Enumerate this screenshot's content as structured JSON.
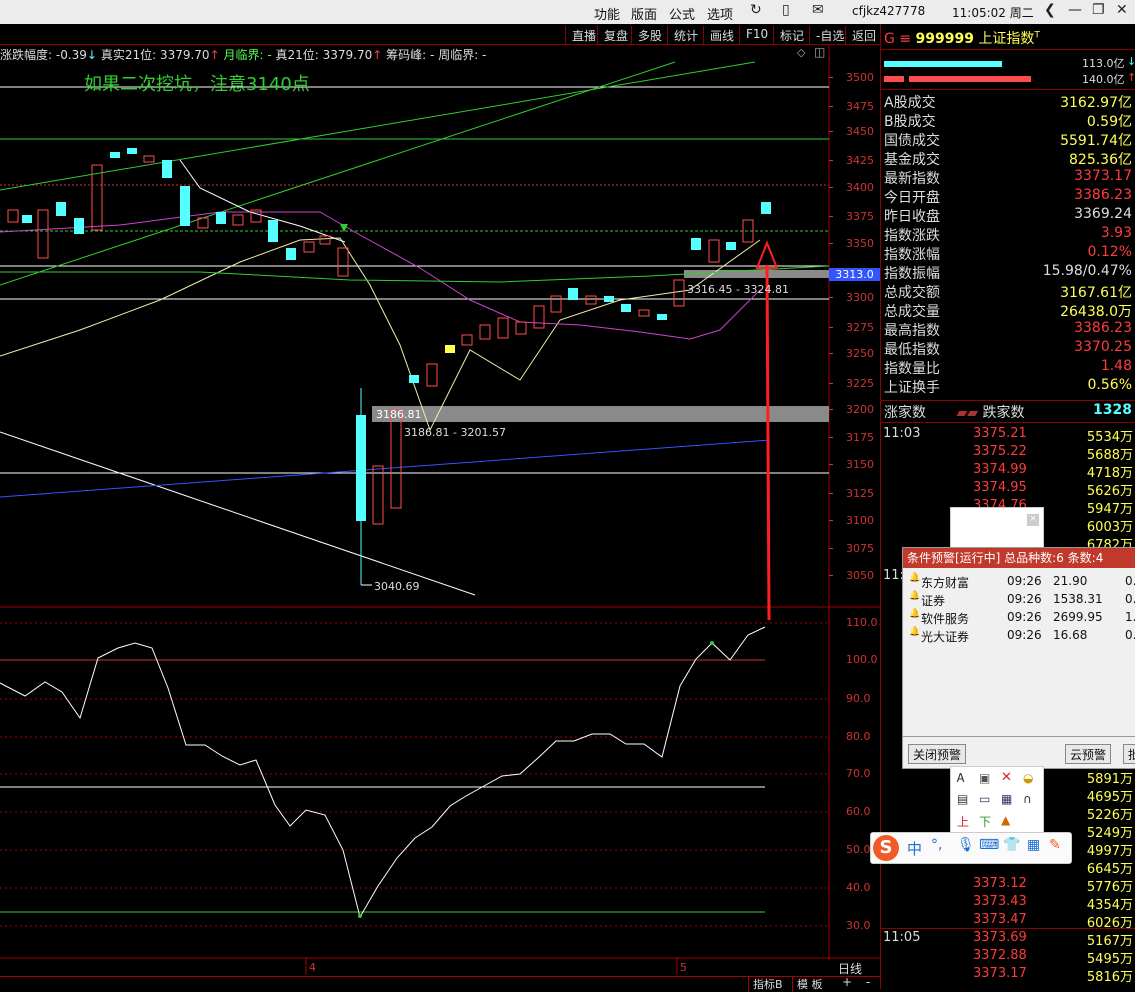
{
  "topbar": {
    "menus": [
      "功能",
      "版面",
      "公式",
      "选项"
    ],
    "user": "cfjkz427778",
    "clock": "11:05:02 周二"
  },
  "toolbar": {
    "buttons": [
      "直播",
      "复盘",
      "多股",
      "统计",
      "画线",
      "F10",
      "标记",
      "-自选",
      "返回"
    ]
  },
  "info_line": {
    "change_pct": "涨跌幅度: -0.39",
    "real21": "真实21位: 3379.70",
    "monthly": "月临界: -",
    "real21b": "真21位: 3379.70",
    "chips": "筹码峰: -",
    "weekly": "周临界: -"
  },
  "annotation": "如果二次挖坑，注意3140点",
  "price_axis": [
    "3500",
    "3475",
    "3450",
    "3425",
    "3400",
    "3375",
    "3350",
    "3300",
    "3275",
    "3250",
    "3225",
    "3200",
    "3175",
    "3150",
    "3125",
    "3100",
    "3075",
    "3050"
  ],
  "price_tag": "3313.0",
  "chart_labels": {
    "zone1": "3186.81",
    "zone1_range": "3186.81 - 3201.57",
    "zone2_range": "3316.45 - 3324.81",
    "low": "3040.69"
  },
  "indicator_axis": [
    "110.0",
    "100.0",
    "90.0",
    "80.0",
    "70.0",
    "60.0",
    "50.0",
    "40.0",
    "30.0"
  ],
  "date_marks": [
    "4",
    "5"
  ],
  "bottom": {
    "period": "日线",
    "tabs": [
      "指标B",
      "模 板"
    ],
    "plus": "+",
    "minus": "-"
  },
  "right_header": {
    "g": "G",
    "menu": "≡",
    "code": "999999",
    "name": "上证指数",
    "sup": "T"
  },
  "bars": {
    "top": "113.0亿",
    "bottom": "140.0亿"
  },
  "stats": [
    {
      "label": "A股成交",
      "value": "3162.97亿",
      "color": "yel"
    },
    {
      "label": "B股成交",
      "value": "0.59亿",
      "color": "yel"
    },
    {
      "label": "国债成交",
      "value": "5591.74亿",
      "color": "yel"
    },
    {
      "label": "基金成交",
      "value": "825.36亿",
      "color": "yel"
    },
    {
      "label": "最新指数",
      "value": "3373.17",
      "color": "red"
    },
    {
      "label": "今日开盘",
      "value": "3386.23",
      "color": "red"
    },
    {
      "label": "昨日收盘",
      "value": "3369.24",
      "color": "wht"
    },
    {
      "label": "指数涨跌",
      "value": "3.93",
      "color": "red"
    },
    {
      "label": "指数涨幅",
      "value": "0.12%",
      "color": "red"
    },
    {
      "label": "指数振幅",
      "value": "15.98/0.47%",
      "color": "wht"
    },
    {
      "label": "总成交额",
      "value": "3167.61亿",
      "color": "yel"
    },
    {
      "label": "总成交量",
      "value": "26438.0万",
      "color": "yel"
    },
    {
      "label": "最高指数",
      "value": "3386.23",
      "color": "red"
    },
    {
      "label": "最低指数",
      "value": "3370.25",
      "color": "red"
    },
    {
      "label": "指数量比",
      "value": "1.48",
      "color": "red"
    },
    {
      "label": "上证换手",
      "value": "0.56%",
      "color": "yel"
    }
  ],
  "updown": {
    "up": "涨家数",
    "down": "跌家数",
    "down_count": "1328"
  },
  "ticks": [
    {
      "time": "11:03",
      "price": "3375.21",
      "vol": "5534万"
    },
    {
      "time": "",
      "price": "3375.22",
      "vol": "5688万"
    },
    {
      "time": "",
      "price": "3374.99",
      "vol": "4718万"
    },
    {
      "time": "",
      "price": "3374.95",
      "vol": "5626万"
    },
    {
      "time": "",
      "price": "3374.76",
      "vol": "5947万"
    },
    {
      "time": "",
      "price": "",
      "vol": "6003万"
    },
    {
      "time": "",
      "price": "",
      "vol": "6782万"
    },
    {
      "time": "",
      "price": "",
      "vol": "5891万"
    },
    {
      "time": "",
      "price": "",
      "vol": "4695万"
    },
    {
      "time": "",
      "price": "",
      "vol": "5226万"
    },
    {
      "time": "",
      "price": "",
      "vol": "5249万"
    },
    {
      "time": "",
      "price": "",
      "vol": "4997万"
    },
    {
      "time": "",
      "price": "",
      "vol": "6645万"
    },
    {
      "time": "",
      "price": "3373.12",
      "vol": "5776万"
    },
    {
      "time": "",
      "price": "3373.43",
      "vol": "4354万"
    },
    {
      "time": "",
      "price": "3373.47",
      "vol": "6026万"
    },
    {
      "time": "11:05",
      "price": "3373.69",
      "vol": "5167万"
    },
    {
      "time": "",
      "price": "3372.88",
      "vol": "5495万"
    },
    {
      "time": "",
      "price": "3373.17",
      "vol": "5816万"
    }
  ],
  "tick_mid_time": "11:",
  "popup": {
    "title": "条件预警[运行中] 总品种数:6 条数:4",
    "rows": [
      {
        "name": "东方财富",
        "time": "09:26",
        "price": "21.90",
        "extra": "0."
      },
      {
        "name": "证券",
        "time": "09:26",
        "price": "1538.31",
        "extra": "0."
      },
      {
        "name": "软件服务",
        "time": "09:26",
        "price": "2699.95",
        "extra": "1."
      },
      {
        "name": "光大证券",
        "time": "09:26",
        "price": "16.68",
        "extra": "0."
      }
    ],
    "close_btn": "关闭预警",
    "cloud_btn": "云预警",
    "more_btn": "批"
  },
  "ime": {
    "lang": "中",
    "punct": "°,"
  }
}
